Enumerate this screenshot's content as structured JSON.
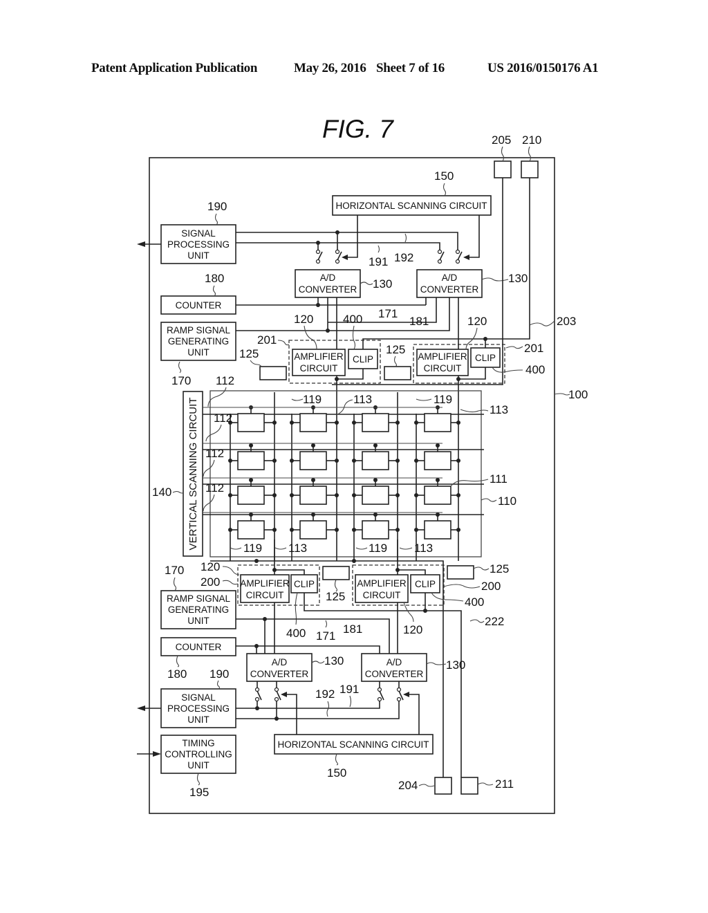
{
  "header": {
    "publication": "Patent Application Publication",
    "date": "May 26, 2016",
    "sheet": "Sheet 7 of 16",
    "patent_number": "US 2016/0150176 A1"
  },
  "figure": {
    "title": "FIG.  7"
  },
  "blocks": {
    "hsc_top": {
      "label": "HORIZONTAL SCANNING CIRCUIT",
      "ref": "150"
    },
    "hsc_bottom": {
      "label": "HORIZONTAL SCANNING CIRCUIT",
      "ref": "150"
    },
    "spu_top": {
      "line1": "SIGNAL",
      "line2": "PROCESSING",
      "line3": "UNIT",
      "ref": "190"
    },
    "spu_bottom": {
      "line1": "SIGNAL",
      "line2": "PROCESSING",
      "line3": "UNIT",
      "ref": "190"
    },
    "counter_top": {
      "label": "COUNTER",
      "ref": "180"
    },
    "counter_bottom": {
      "label": "COUNTER",
      "ref": "180"
    },
    "ramp_top": {
      "line1": "RAMP SIGNAL",
      "line2": "GENERATING",
      "line3": "UNIT",
      "ref": "170"
    },
    "ramp_bottom": {
      "line1": "RAMP SIGNAL",
      "line2": "GENERATING",
      "line3": "UNIT",
      "ref": "170"
    },
    "adc": {
      "line1": "A/D",
      "line2": "CONVERTER",
      "ref": "130"
    },
    "amp": {
      "line1": "AMPLIFIER",
      "line2": "CIRCUIT",
      "ref": "120"
    },
    "clip": {
      "label": "CLIP",
      "ref": "400"
    },
    "vsc": {
      "label": "VERTICAL SCANNING CIRCUIT",
      "ref": "140"
    },
    "timing": {
      "line1": "TIMING",
      "line2": "CONTROLLING",
      "line3": "UNIT",
      "ref": "195"
    }
  },
  "refs": {
    "chip": "100",
    "pixel_array": "110",
    "pixel": "111",
    "row_line": "112",
    "column_line": "113",
    "column_line_b": "119",
    "current_source": "125",
    "ramp_line": "171",
    "counter_line": "181",
    "bus_191": "191",
    "bus_192": "192",
    "group_bottom": "200",
    "group_top": "201",
    "line_203": "203",
    "line_222": "222",
    "pad_204": "204",
    "pad_205": "205",
    "pad_210": "210",
    "pad_211": "211"
  }
}
